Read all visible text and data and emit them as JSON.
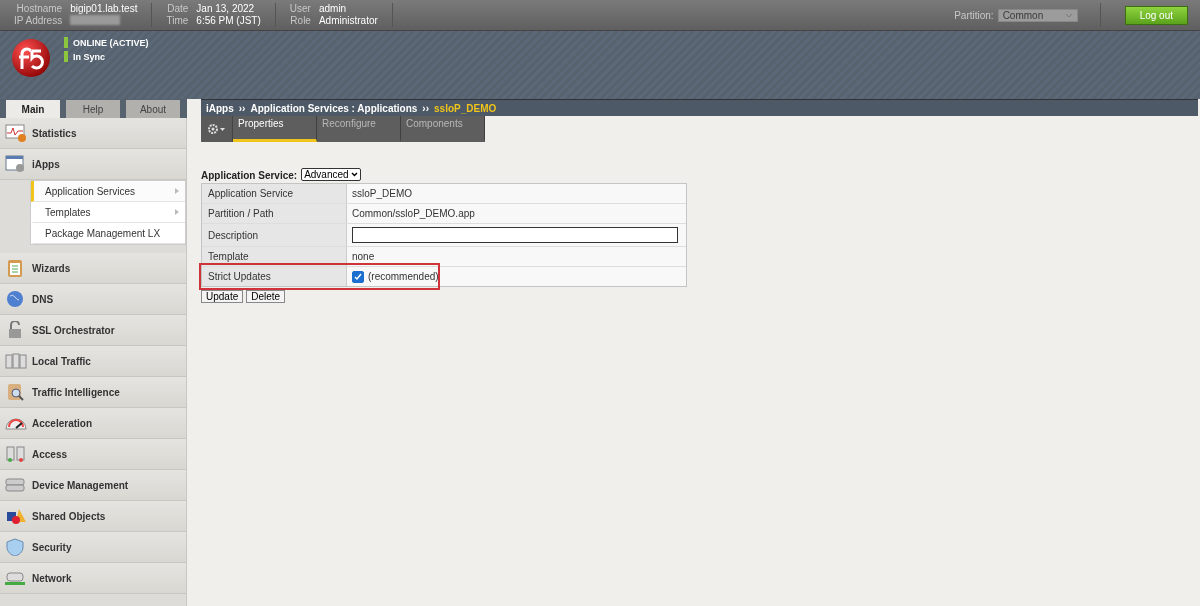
{
  "top_bar": {
    "hostname_label": "Hostname",
    "hostname": "bigip01.lab.test",
    "ip_label": "IP Address",
    "ip_redacted": true,
    "date_label": "Date",
    "date": "Jan 13, 2022",
    "time_label": "Time",
    "time": "6:56 PM (JST)",
    "user_label": "User",
    "user": "admin",
    "role_label": "Role",
    "role": "Administrator",
    "partition_label": "Partition:",
    "partition": "Common",
    "logout": "Log out"
  },
  "status": [
    {
      "text": "ONLINE (ACTIVE)",
      "color": "#8cc63f"
    },
    {
      "text": "In Sync",
      "color": "#8cc63f"
    }
  ],
  "nav_tabs": [
    {
      "label": "Main",
      "selected": true
    },
    {
      "label": "Help",
      "selected": false
    },
    {
      "label": "About",
      "selected": false
    }
  ],
  "sidebar": [
    {
      "label": "Statistics"
    },
    {
      "label": "iApps",
      "children": [
        {
          "label": "Application Services",
          "selected": true,
          "arrow": true
        },
        {
          "label": "Templates",
          "selected": false,
          "arrow": true
        },
        {
          "label": "Package Management LX",
          "selected": false,
          "arrow": false
        }
      ]
    },
    {
      "label": "Wizards"
    },
    {
      "label": "DNS"
    },
    {
      "label": "SSL Orchestrator"
    },
    {
      "label": "Local Traffic"
    },
    {
      "label": "Traffic Intelligence"
    },
    {
      "label": "Acceleration"
    },
    {
      "label": "Access"
    },
    {
      "label": "Device Management"
    },
    {
      "label": "Shared Objects"
    },
    {
      "label": "Security"
    },
    {
      "label": "Network"
    }
  ],
  "breadcrumb": {
    "items": [
      "iApps",
      "Application Services : Applications"
    ],
    "separator": "››",
    "current": "ssloP_DEMO"
  },
  "page_tabs": [
    {
      "label": "Properties",
      "selected": true
    },
    {
      "label": "Reconfigure",
      "selected": false
    },
    {
      "label": "Components",
      "selected": false
    }
  ],
  "form": {
    "label": "Application Service:",
    "mode": "Advanced",
    "rows": [
      {
        "label": "Application Service",
        "kind": "text",
        "value": "ssloP_DEMO",
        "highlighted": false
      },
      {
        "label": "Partition / Path",
        "kind": "text",
        "value": "Common/ssloP_DEMO.app",
        "highlighted": false
      },
      {
        "label": "Description",
        "kind": "input",
        "highlighted": false
      },
      {
        "label": "Template",
        "kind": "text",
        "value": "none",
        "highlighted": false
      },
      {
        "label": "Strict Updates",
        "kind": "checkbox",
        "checked": true,
        "value": "(recommended)",
        "highlighted": true
      }
    ],
    "buttons": [
      "Update",
      "Delete"
    ]
  }
}
